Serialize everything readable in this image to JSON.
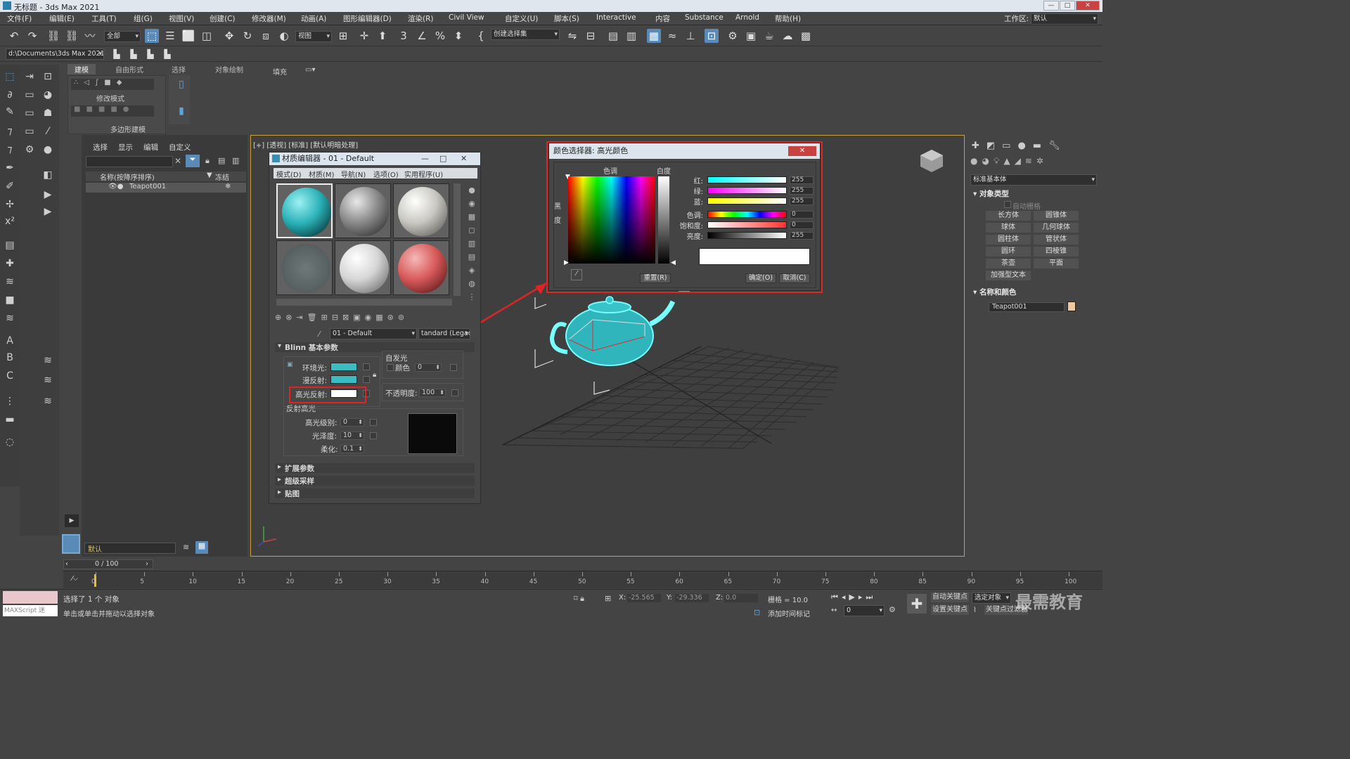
{
  "window": {
    "title": "无标题 - 3ds Max 2021"
  },
  "menu": [
    "文件(F)",
    "编辑(E)",
    "工具(T)",
    "组(G)",
    "视图(V)",
    "创建(C)",
    "修改器(M)",
    "动画(A)",
    "图形编辑器(D)",
    "渲染(R)",
    "Civil View",
    "自定义(U)",
    "脚本(S)",
    "Interactive",
    "内容",
    "Substance",
    "Arnold",
    "帮助(H)"
  ],
  "workspace": {
    "label": "工作区:",
    "value": "默认"
  },
  "toolbar": {
    "filter": "全部",
    "view": "视图",
    "selection_set": "创建选择集"
  },
  "toolbar2": {
    "path": "d:\\Documents\\3ds Max 2021"
  },
  "ribbon": {
    "tabs": [
      "建模",
      "自由形式",
      "选择",
      "对象绘制",
      "填充"
    ],
    "mode_label": "修改模式",
    "poly_label": "多边形建模"
  },
  "scene_explorer": {
    "tabs": [
      "选择",
      "显示",
      "编辑",
      "自定义"
    ],
    "col_name": "名称(按降序排序)",
    "col_frozen": "冻结",
    "item": "Teapot001",
    "layer": "默认"
  },
  "viewport": {
    "label": "[+] [透视] [标准] [默认明暗处理]"
  },
  "material_editor": {
    "title": "材质编辑器 - 01 - Default",
    "menu": [
      "模式(D)",
      "材质(M)",
      "导航(N)",
      "选项(O)",
      "实用程序(U)"
    ],
    "material_name": "01 - Default",
    "material_type": "tandard (Legacy",
    "section_blinn": "Blinn 基本参数",
    "ambient": "环境光:",
    "diffuse": "漫反射:",
    "specular": "高光反射:",
    "self_illum": "自发光",
    "color_label": "颜色",
    "self_illum_val": "0",
    "opacity": "不透明度:",
    "opacity_val": "100",
    "spec_highlight": "反射高光",
    "spec_level": "高光级别:",
    "spec_level_val": "0",
    "gloss": "光泽度:",
    "gloss_val": "10",
    "soften": "柔化:",
    "soften_val": "0.1",
    "rollouts": [
      "扩展参数",
      "超级采样",
      "贴图"
    ],
    "colors": {
      "ambient": "#3bbcc3",
      "diffuse": "#3bbcc3",
      "specular": "#ffffff"
    }
  },
  "color_picker": {
    "title": "颜色选择器: 高光颜色",
    "hue_label": "色调",
    "white_label": "白度",
    "black_label": "黑度",
    "rows": [
      {
        "label": "红:",
        "value": "255"
      },
      {
        "label": "绿:",
        "value": "255"
      },
      {
        "label": "蓝:",
        "value": "255"
      },
      {
        "label": "色调:",
        "value": "0"
      },
      {
        "label": "饱和度:",
        "value": "0"
      },
      {
        "label": "亮度:",
        "value": "255"
      }
    ],
    "reset": "重置(R)",
    "ok": "确定(O)",
    "cancel": "取消(C)",
    "current_color": "#ffffff"
  },
  "command_panel": {
    "category": "标准基本体",
    "object_type": "对象类型",
    "autogrid": "自动栅格",
    "buttons": [
      "长方体",
      "圆锥体",
      "球体",
      "几何球体",
      "圆柱体",
      "管状体",
      "圆环",
      "四棱锥",
      "茶壶",
      "平面",
      "加强型文本"
    ],
    "name_color": "名称和颜色",
    "object_name": "Teapot001",
    "object_color": "#f0c8a0"
  },
  "timeline": {
    "frame": "0 / 100",
    "ticks": [
      "0",
      "5",
      "10",
      "15",
      "20",
      "25",
      "30",
      "35",
      "40",
      "45",
      "50",
      "55",
      "60",
      "65",
      "70",
      "75",
      "80",
      "85",
      "90",
      "95",
      "100"
    ]
  },
  "status": {
    "script_label": "MAXScript 迷",
    "selected": "选择了 1 个 对象",
    "hint": "单击或单击并拖动以选择对象",
    "x_label": "X:",
    "x": "-25.565",
    "y_label": "Y:",
    "y": "-29.336",
    "z_label": "Z:",
    "z": "0.0",
    "grid": "栅格 = 10.0",
    "add_time_tag": "添加时间标记",
    "auto_key": "自动关键点",
    "selected_obj": "选定对象",
    "set_key": "设置关键点",
    "key_filter": "关键点过滤器",
    "frame_field": "0",
    "watermark": "最需教育"
  }
}
